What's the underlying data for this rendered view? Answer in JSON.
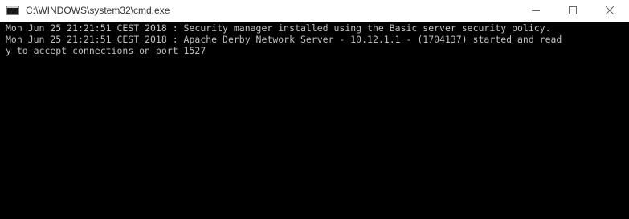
{
  "window": {
    "title": "C:\\WINDOWS\\system32\\cmd.exe",
    "icon": "cmd-console-icon",
    "controls": {
      "minimize": "minimize-icon",
      "maximize": "maximize-icon",
      "close": "close-icon"
    }
  },
  "console": {
    "lines": [
      "Mon Jun 25 21:21:51 CEST 2018 : Security manager installed using the Basic server security policy.",
      "Mon Jun 25 21:21:51 CEST 2018 : Apache Derby Network Server - 10.12.1.1 - (1704137) started and read",
      "y to accept connections on port 1527"
    ],
    "colors": {
      "background": "#000000",
      "foreground": "#c0c0c0"
    }
  }
}
